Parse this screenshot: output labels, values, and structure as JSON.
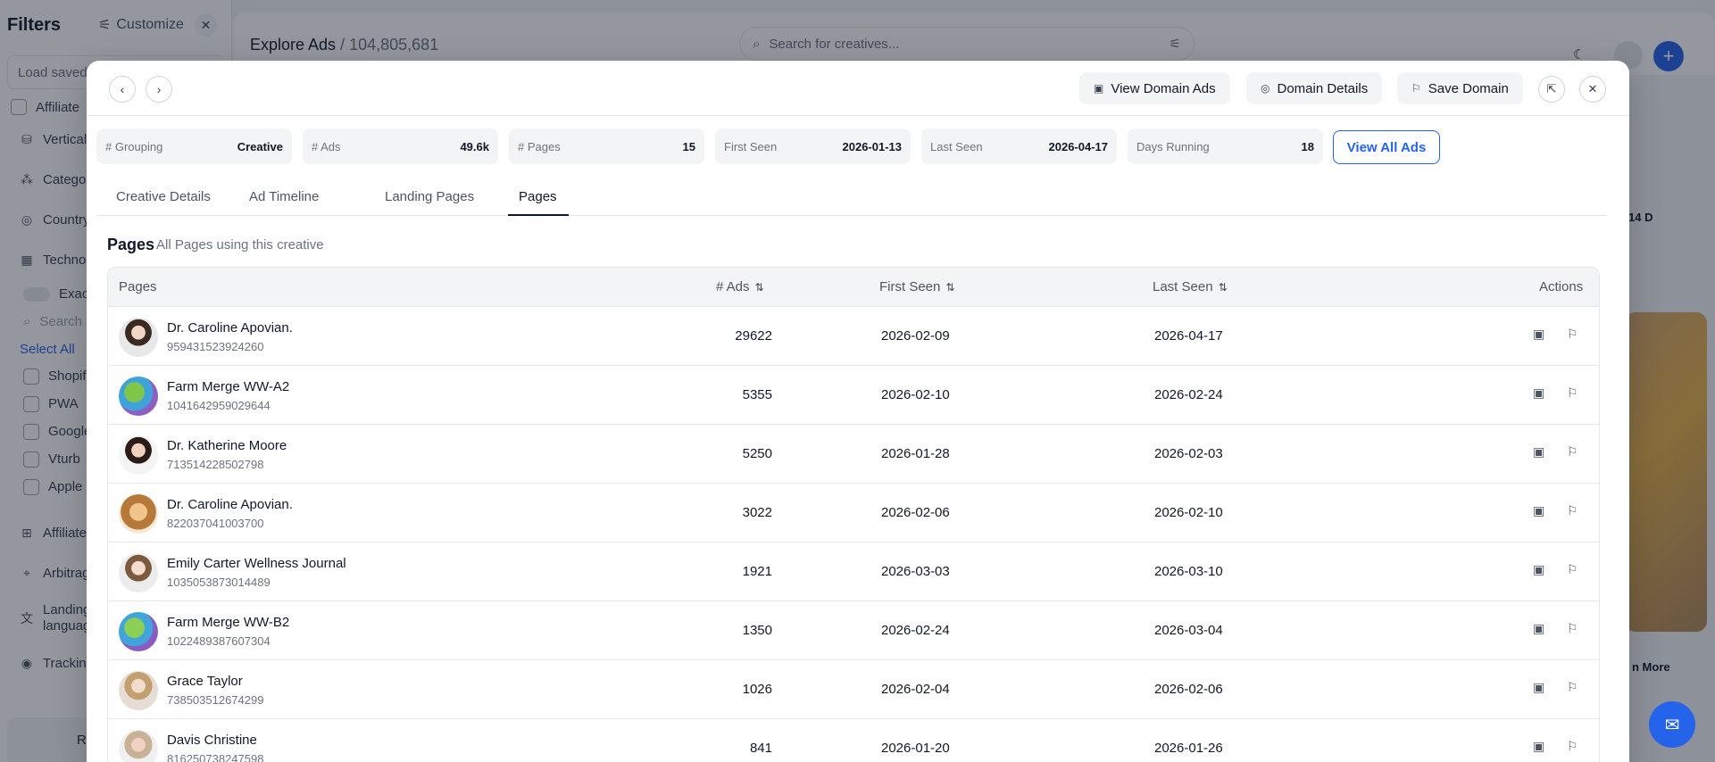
{
  "sidebar": {
    "title": "Filters",
    "customize_label": "Customize",
    "load_saved_placeholder": "Load saved",
    "items": [
      {
        "label": "Affiliate"
      },
      {
        "label": "Vertical"
      },
      {
        "label": "Catego"
      },
      {
        "label": "Country"
      },
      {
        "label": "Techno"
      }
    ],
    "exact_label": "Exact",
    "search_placeholder": "Search",
    "select_all": "Select All",
    "tech_options": [
      "Shopif",
      "PWA",
      "Google",
      "Vturb",
      "Apple"
    ],
    "more_items": [
      {
        "label": "Affiliate"
      },
      {
        "label": "Arbitrag"
      },
      {
        "label": "Landing languag"
      },
      {
        "label": "Tracking"
      }
    ],
    "bottom_button": "R"
  },
  "app": {
    "breadcrumb_title": "Explore Ads",
    "breadcrumb_sep": "/",
    "breadcrumb_count": "104,805,681",
    "search_placeholder": "Search for creatives...",
    "bg_badge": "14 D",
    "bg_more": "n More"
  },
  "modal": {
    "header_buttons": {
      "view_domain_ads": "View Domain Ads",
      "domain_details": "Domain Details",
      "save_domain": "Save Domain"
    },
    "stats": [
      {
        "label": "# Grouping",
        "value": "Creative"
      },
      {
        "label": "# Ads",
        "value": "49.6k"
      },
      {
        "label": "# Pages",
        "value": "15"
      },
      {
        "label": "First Seen",
        "value": "2026-01-13"
      },
      {
        "label": "Last Seen",
        "value": "2026-04-17"
      },
      {
        "label": "Days Running",
        "value": "18"
      }
    ],
    "view_all_ads": "View All Ads",
    "tabs": [
      {
        "label": "Creative Details"
      },
      {
        "label": "Ad Timeline"
      },
      {
        "label": "Landing Pages"
      },
      {
        "label": "Pages",
        "active": true
      }
    ],
    "section_title": "Pages",
    "section_subtitle": "All Pages using this creative",
    "table": {
      "columns": {
        "pages": "Pages",
        "ads": "# Ads",
        "first_seen": "First Seen",
        "last_seen": "Last Seen",
        "actions": "Actions"
      },
      "rows": [
        {
          "name": "Dr. Caroline Apovian.",
          "id": "959431523924260",
          "ads": "29622",
          "first_seen": "2026-02-09",
          "last_seen": "2026-04-17"
        },
        {
          "name": "Farm Merge WW-A2",
          "id": "1041642959029644",
          "ads": "5355",
          "first_seen": "2026-02-10",
          "last_seen": "2026-02-24"
        },
        {
          "name": "Dr. Katherine Moore",
          "id": "713514228502798",
          "ads": "5250",
          "first_seen": "2026-01-28",
          "last_seen": "2026-02-03"
        },
        {
          "name": "Dr. Caroline Apovian.",
          "id": "822037041003700",
          "ads": "3022",
          "first_seen": "2026-02-06",
          "last_seen": "2026-02-10"
        },
        {
          "name": "Emily Carter Wellness Journal",
          "id": "1035053873014489",
          "ads": "1921",
          "first_seen": "2026-03-03",
          "last_seen": "2026-03-10"
        },
        {
          "name": "Farm Merge WW-B2",
          "id": "1022489387607304",
          "ads": "1350",
          "first_seen": "2026-02-24",
          "last_seen": "2026-03-04"
        },
        {
          "name": "Grace Taylor",
          "id": "738503512674299",
          "ads": "1026",
          "first_seen": "2026-02-04",
          "last_seen": "2026-02-06"
        },
        {
          "name": "Davis Christine",
          "id": "816250738247598",
          "ads": "841",
          "first_seen": "2026-01-20",
          "last_seen": "2026-01-26"
        }
      ]
    }
  }
}
